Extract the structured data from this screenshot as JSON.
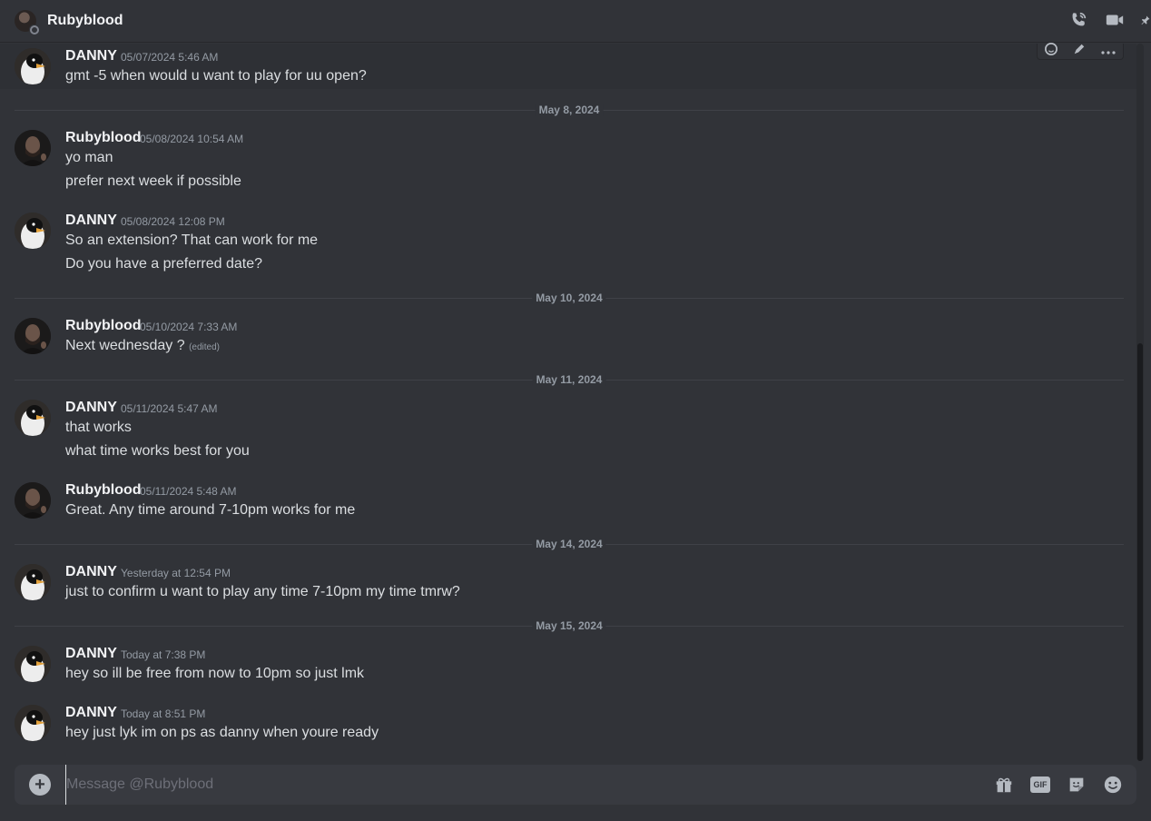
{
  "header": {
    "title": "Rubyblood"
  },
  "composer": {
    "placeholder": "Message @Rubyblood"
  },
  "dividers": [
    "May 8, 2024",
    "May 10, 2024",
    "May 11, 2024",
    "May 14, 2024",
    "May 15, 2024"
  ],
  "messages": [
    {
      "author": "DANNY",
      "time": "05/07/2024 5:46 AM",
      "lines": [
        "gmt -5 when would u want to play for uu open?"
      ]
    },
    {
      "author": "Rubyblood",
      "time": "05/08/2024 10:54 AM",
      "lines": [
        "yo man",
        "prefer next week if possible"
      ]
    },
    {
      "author": "DANNY",
      "time": "05/08/2024 12:08 PM",
      "lines": [
        "So an extension? That can work for me",
        "Do you have a preferred date?"
      ]
    },
    {
      "author": "Rubyblood",
      "time": "05/10/2024 7:33 AM",
      "lines": [
        "Next wednesday ?"
      ],
      "edited": "(edited)"
    },
    {
      "author": "DANNY",
      "time": "05/11/2024 5:47 AM",
      "lines": [
        "that works",
        "what time works best for you"
      ]
    },
    {
      "author": "Rubyblood",
      "time": "05/11/2024 5:48 AM",
      "lines": [
        "Great. Any time around 7-10pm works for me"
      ]
    },
    {
      "author": "DANNY",
      "time": "Yesterday at 12:54 PM",
      "lines": [
        "just to confirm u want to play any time 7-10pm my time tmrw?"
      ]
    },
    {
      "author": "DANNY",
      "time": "Today at 7:38 PM",
      "lines": [
        "hey so ill be free from now to 10pm so just lmk"
      ]
    },
    {
      "author": "DANNY",
      "time": "Today at 8:51 PM",
      "lines": [
        "hey just lyk im on ps as danny when youre ready"
      ]
    }
  ],
  "composer_icons": {
    "gif_label": "GIF"
  },
  "colors": {
    "background": "#313338",
    "composer": "#383a40",
    "muted": "#949ba4"
  }
}
